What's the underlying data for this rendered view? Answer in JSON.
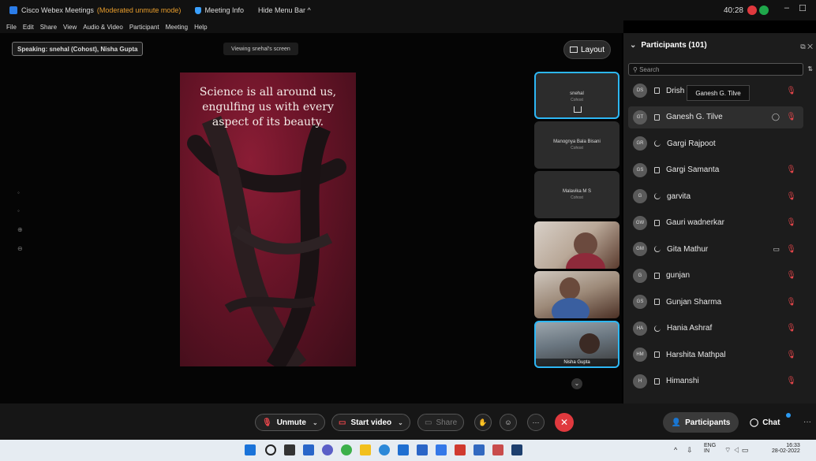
{
  "titlebar": {
    "app_title": "Cisco Webex Meetings",
    "mode": "(Moderated unmute mode)",
    "meeting_info": "Meeting Info",
    "hide_menu": "Hide Menu Bar ^",
    "timer": "40:28",
    "minimize": "–",
    "restore": "☐"
  },
  "menu": [
    "File",
    "Edit",
    "Share",
    "View",
    "Audio & Video",
    "Participant",
    "Meeting",
    "Help"
  ],
  "stage": {
    "speaking": "Speaking: snehal (Cohost), Nisha Gupta",
    "viewing": "Viewing snehal's screen",
    "layout_label": "Layout",
    "shared_quote": "Science is all around us, engulfing us with every aspect of its beauty."
  },
  "video_tiles": [
    {
      "name": "snehal",
      "role": "Cohost"
    },
    {
      "name": "Manognya Bala Bisani",
      "role": "Cohost"
    },
    {
      "name": "Malavika M S",
      "role": "Cohost"
    },
    {
      "name": ""
    },
    {
      "name": ""
    },
    {
      "name": "Nisha Gupta"
    }
  ],
  "participants": {
    "title": "Participants (101)",
    "search_placeholder": "Search",
    "tooltip": "Ganesh G. Tilve",
    "list": [
      {
        "initials": "DS",
        "name": "Drish",
        "device": "video",
        "muted": true
      },
      {
        "initials": "GT",
        "name": "Ganesh G. Tilve",
        "device": "video",
        "muted": true,
        "chat": true,
        "selected": true
      },
      {
        "initials": "GR",
        "name": "Gargi Rajpoot",
        "device": "audio",
        "muted": false
      },
      {
        "initials": "GS",
        "name": "Gargi Samanta",
        "device": "video",
        "muted": true
      },
      {
        "initials": "G",
        "name": "garvita",
        "device": "audio",
        "muted": true
      },
      {
        "initials": "GW",
        "name": "Gauri wadnerkar",
        "device": "video",
        "muted": true
      },
      {
        "initials": "GM",
        "name": "Gita Mathur",
        "device": "audio",
        "muted": true,
        "video": true
      },
      {
        "initials": "G",
        "name": "gunjan",
        "device": "video",
        "muted": true
      },
      {
        "initials": "GS",
        "name": "Gunjan Sharma",
        "device": "video",
        "muted": true
      },
      {
        "initials": "HA",
        "name": "Hania Ashraf",
        "device": "audio",
        "muted": true
      },
      {
        "initials": "HM",
        "name": "Harshita Mathpal",
        "device": "video",
        "muted": true
      },
      {
        "initials": "H",
        "name": "Himanshi",
        "device": "video",
        "muted": true
      }
    ]
  },
  "controls": {
    "unmute": "Unmute",
    "start_video": "Start video",
    "share": "Share",
    "participants": "Participants",
    "chat": "Chat"
  },
  "taskbar": {
    "lang_top": "ENG",
    "lang_bottom": "IN",
    "time": "16:33",
    "date": "28-02-2022"
  },
  "colors": {
    "accent": "#2db7f5",
    "mute_red": "#e8464b",
    "end_red": "#e0393e",
    "mode_orange": "#e89d2c"
  }
}
